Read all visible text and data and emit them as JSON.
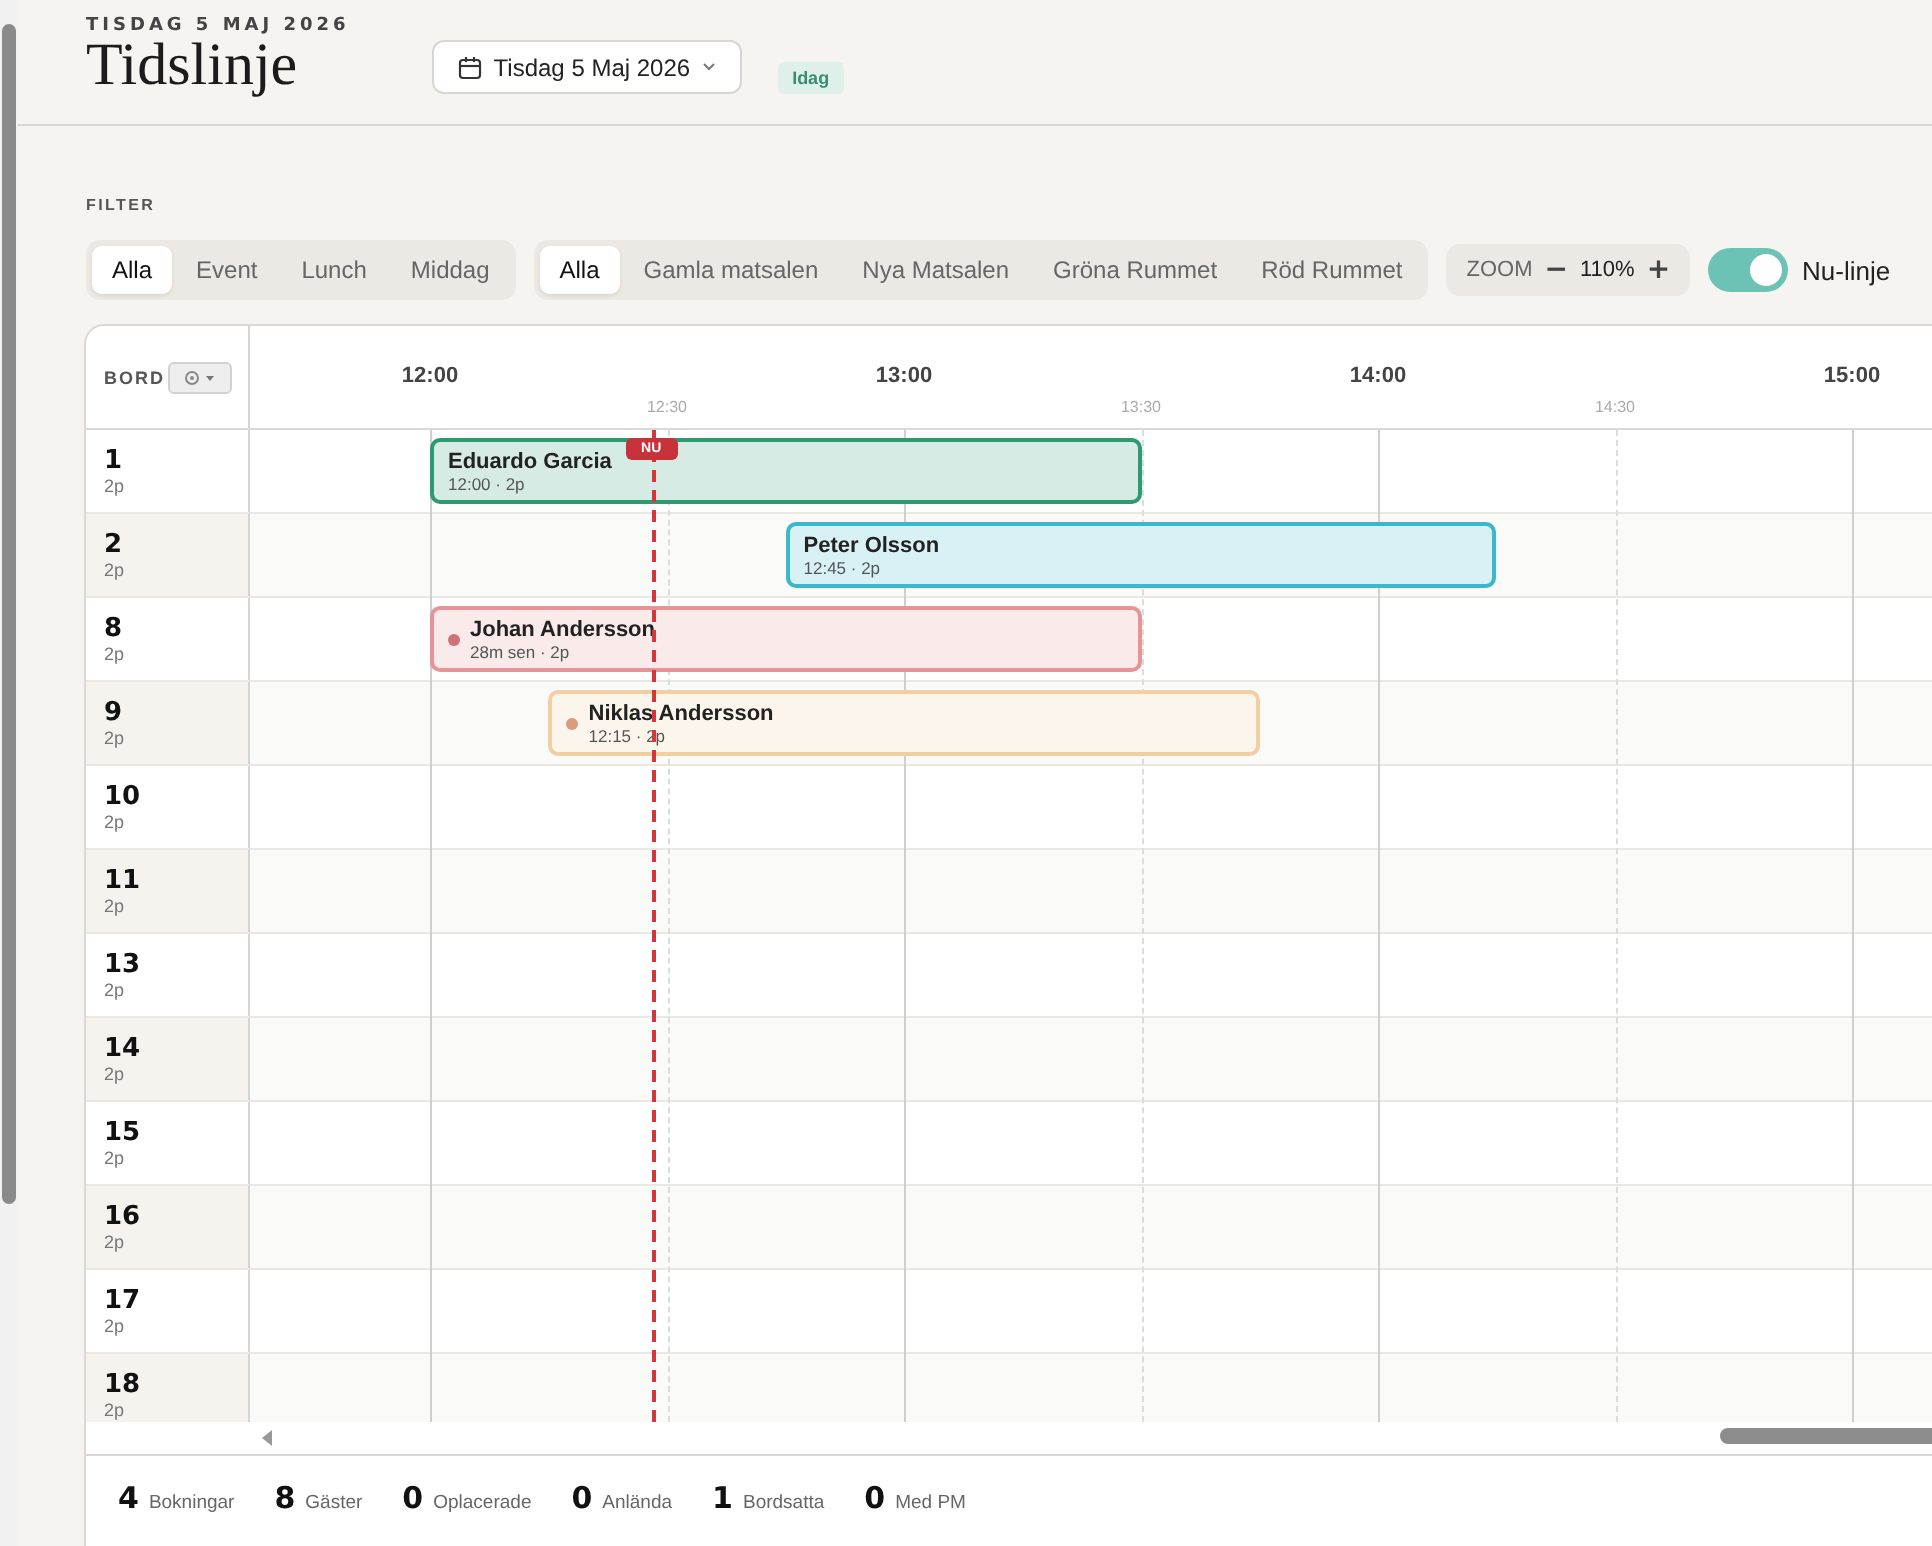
{
  "header": {
    "date_caption": "TISDAG 5 MAJ 2026",
    "title": "Tidslinje",
    "date_picker": "Tisdag 5 Maj 2026",
    "today_badge": "Idag"
  },
  "filter": {
    "label": "FILTER",
    "meal_tabs": [
      {
        "label": "Alla",
        "selected": true
      },
      {
        "label": "Event",
        "selected": false
      },
      {
        "label": "Lunch",
        "selected": false
      },
      {
        "label": "Middag",
        "selected": false
      }
    ],
    "room_tabs": [
      {
        "label": "Alla",
        "selected": true
      },
      {
        "label": "Gamla matsalen",
        "selected": false
      },
      {
        "label": "Nya Matsalen",
        "selected": false
      },
      {
        "label": "Gröna Rummet",
        "selected": false
      },
      {
        "label": "Röd Rummet",
        "selected": false
      }
    ],
    "zoom": {
      "label": "ZOOM",
      "minus": "−",
      "value": "110%",
      "plus": "+"
    },
    "now_toggle": {
      "label": "Nu-linje",
      "on": true
    }
  },
  "timeline": {
    "column_header": "BORD",
    "hours": [
      "12:00",
      "13:00",
      "14:00",
      "15:00"
    ],
    "half_hours": [
      "12:30",
      "13:30",
      "14:30"
    ],
    "now": {
      "label": "NU"
    },
    "tables": [
      {
        "number": "1",
        "seats": "2p",
        "bookings": [
          {
            "name": "Eduardo Garcia",
            "detail": "12:00 · 2p",
            "color": "#2e9a72",
            "dot": false
          }
        ]
      },
      {
        "number": "2",
        "seats": "2p",
        "bookings": [
          {
            "name": "Peter Olsson",
            "detail": "12:45 · 2p",
            "color": "#3bb8cc",
            "dot": false
          }
        ]
      },
      {
        "number": "8",
        "seats": "2p",
        "bookings": [
          {
            "name": "Johan Andersson",
            "detail": "28m sen · 2p",
            "color": "#e69497",
            "dot": true
          }
        ]
      },
      {
        "number": "9",
        "seats": "2p",
        "bookings": [
          {
            "name": "Niklas Andersson",
            "detail": "12:15 · 2p",
            "color": "#f2cfa2",
            "dot": true
          }
        ]
      },
      {
        "number": "10",
        "seats": "2p"
      },
      {
        "number": "11",
        "seats": "2p"
      },
      {
        "number": "13",
        "seats": "2p"
      },
      {
        "number": "14",
        "seats": "2p"
      },
      {
        "number": "15",
        "seats": "2p"
      },
      {
        "number": "16",
        "seats": "2p"
      },
      {
        "number": "17",
        "seats": "2p"
      },
      {
        "number": "18",
        "seats": "2p"
      }
    ]
  },
  "stats": [
    {
      "count": "4",
      "label": "Bokningar"
    },
    {
      "count": "8",
      "label": "Gäster"
    },
    {
      "count": "0",
      "label": "Oplacerade"
    },
    {
      "count": "0",
      "label": "Anlända"
    },
    {
      "count": "1",
      "label": "Bordsatta"
    },
    {
      "count": "0",
      "label": "Med PM"
    }
  ]
}
